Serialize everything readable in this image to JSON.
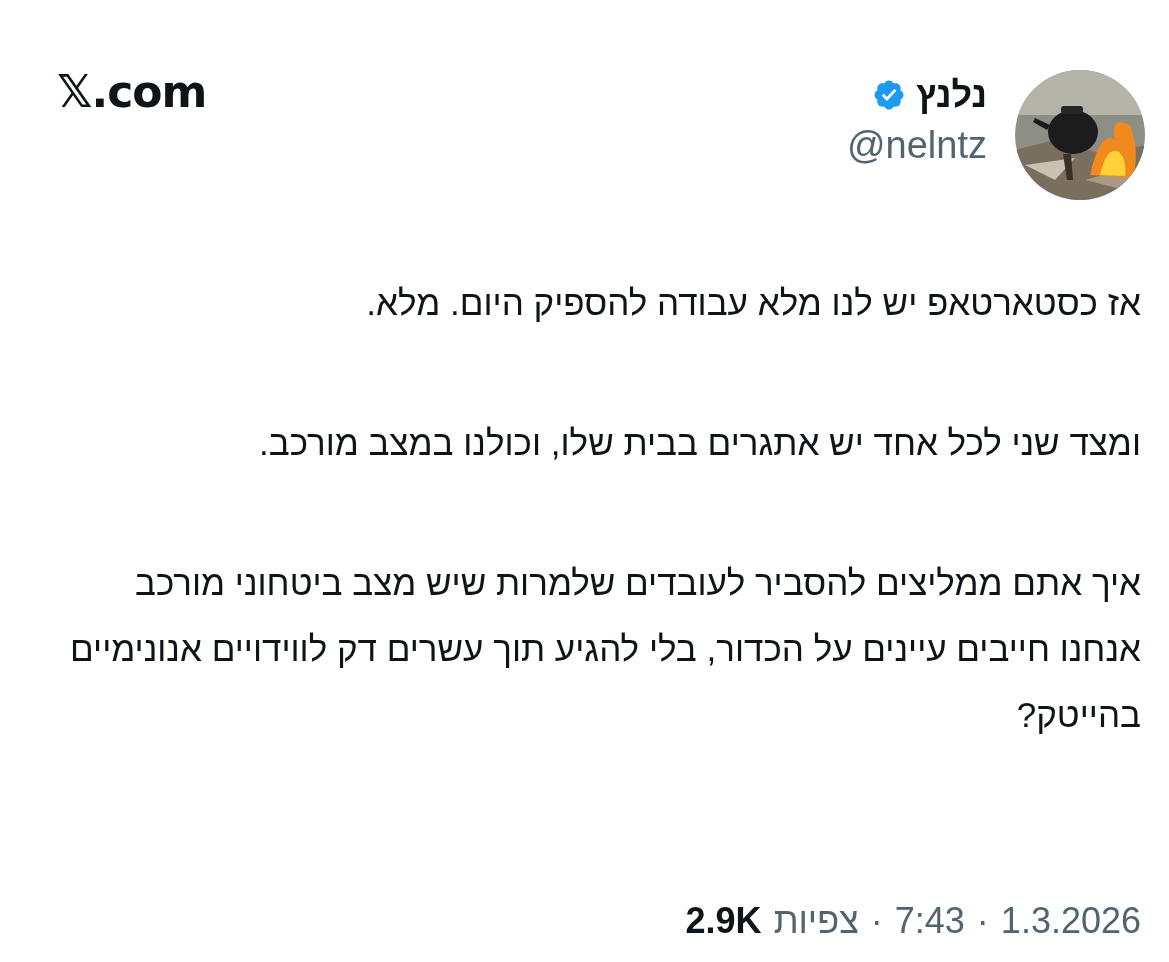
{
  "site": {
    "label": "𝕏.com"
  },
  "author": {
    "name": "נלנץ",
    "verified": true,
    "handle": "@nelntz"
  },
  "paragraphs": [
    "אז כסטארטאפ יש לנו מלא עבודה להספיק היום. מלא.",
    "ומצד שני לכל אחד יש אתגרים בבית שלו, וכולנו במצב מורכב.",
    "איך אתם ממליצים להסביר לעובדים שלמרות שיש מצב ביטחוני מורכב אנחנו חייבים עיינים על הכדור, בלי להגיע תוך עשרים דק לווידויים אנונימיים בהייטק?"
  ],
  "footer": [
    {
      "kind": "date",
      "text": "1.3.2026"
    },
    {
      "kind": "separator",
      "text": "·"
    },
    {
      "kind": "time",
      "text": "7:43"
    },
    {
      "kind": "separator",
      "text": "·"
    },
    {
      "kind": "views_label",
      "text": "צפיות"
    },
    {
      "kind": "views_count",
      "text": "2.9K"
    }
  ]
}
